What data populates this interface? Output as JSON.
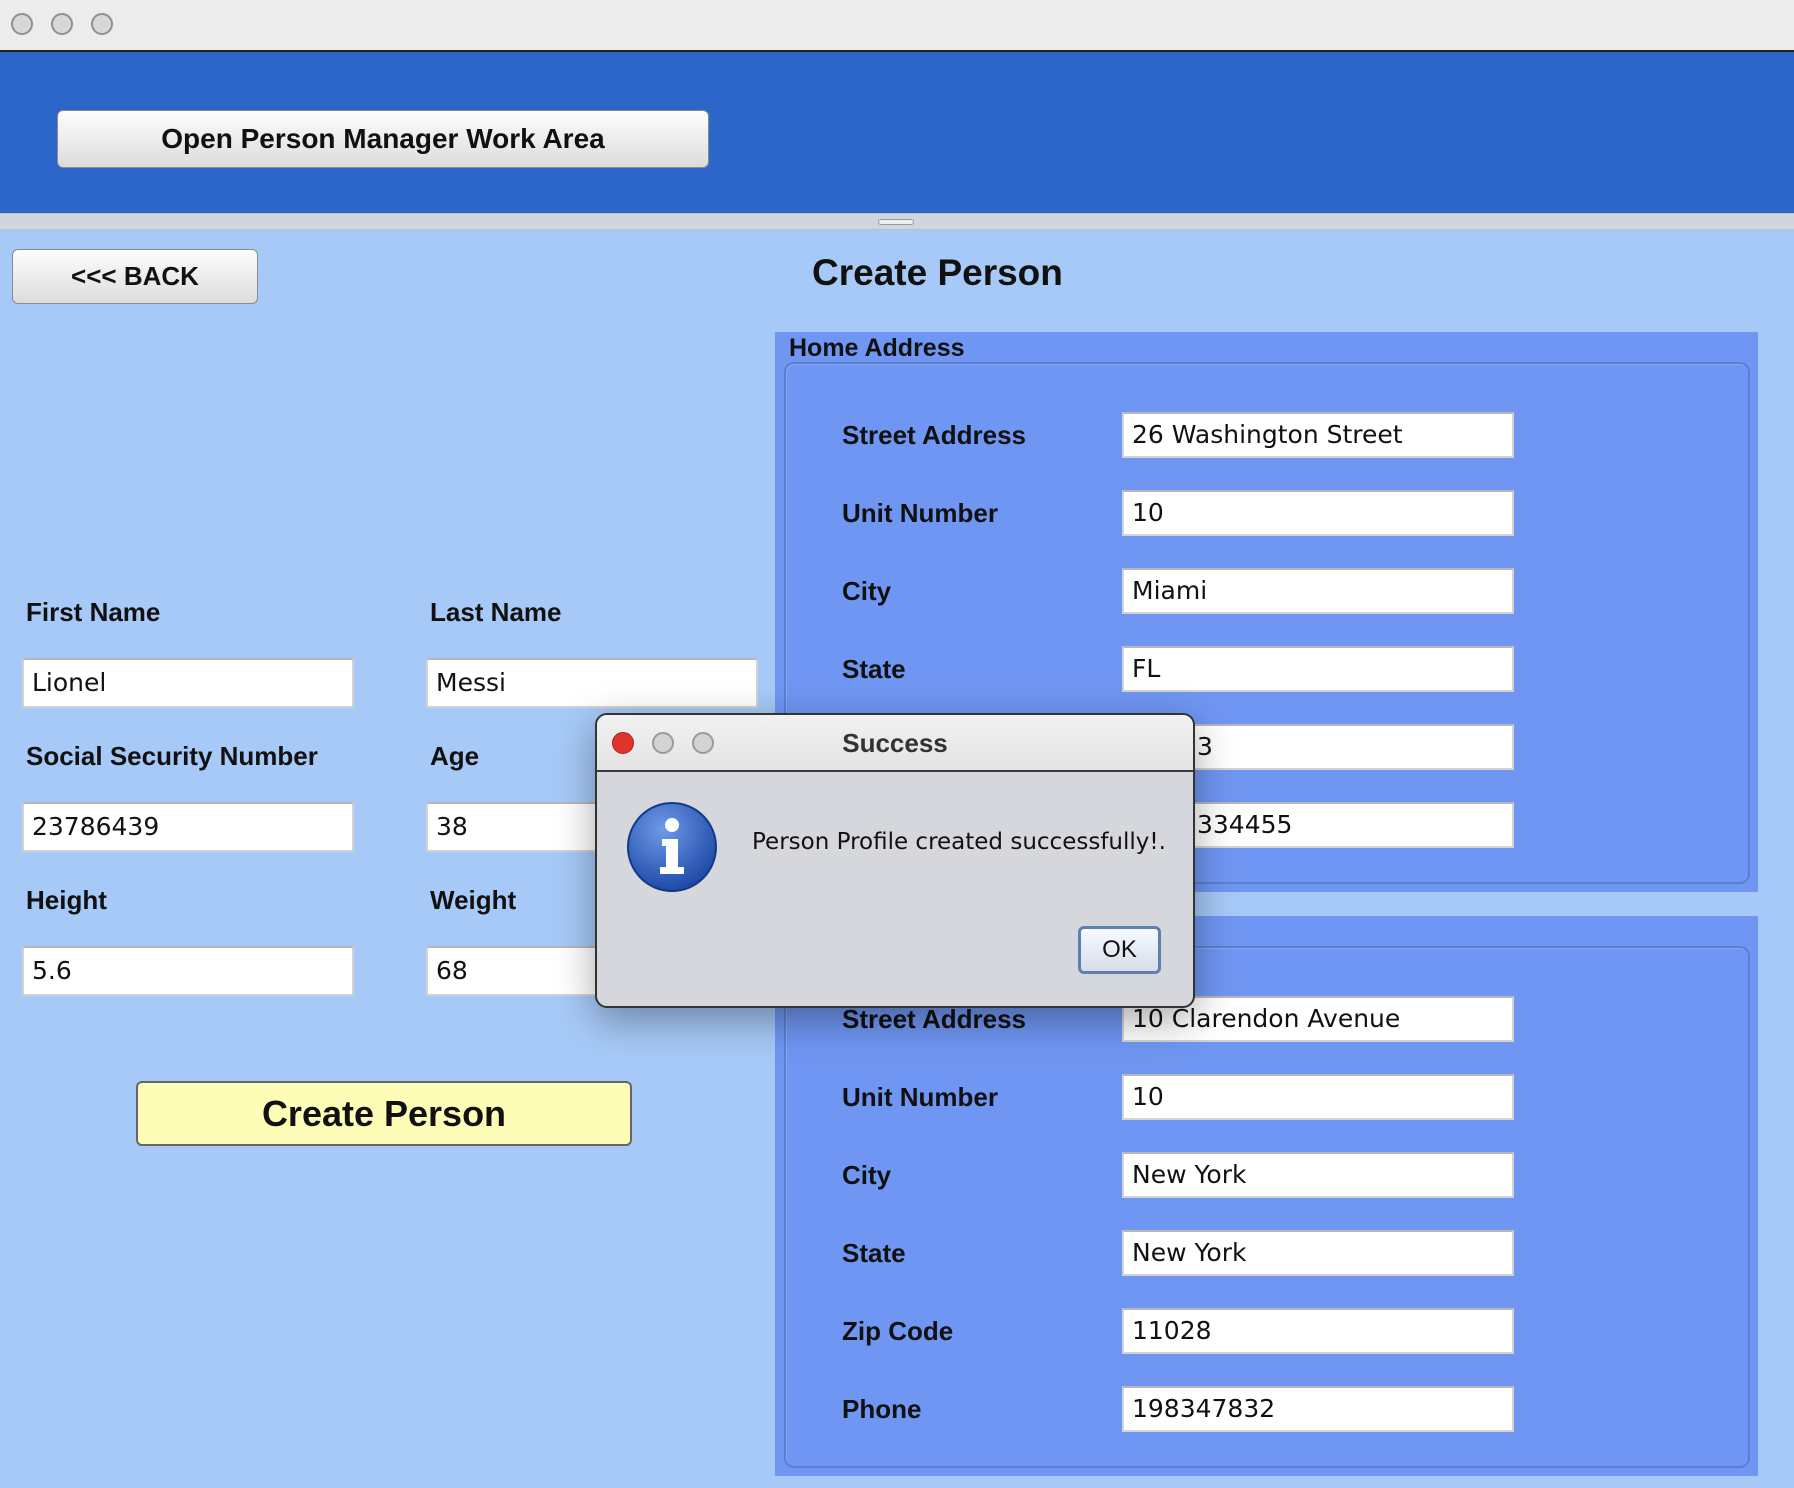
{
  "window": {
    "open_work_area_button": "Open Person Manager Work Area",
    "back_button": "<<< BACK",
    "page_title": "Create Person"
  },
  "person": {
    "first_name_label": "First Name",
    "first_name": "Lionel",
    "last_name_label": "Last Name",
    "last_name": "Messi",
    "ssn_label": "Social Security Number",
    "ssn": "23786439",
    "age_label": "Age",
    "age": "38",
    "height_label": "Height",
    "height": "5.6",
    "weight_label": "Weight",
    "weight": "68",
    "create_button": "Create Person"
  },
  "home_address": {
    "title": "Home Address",
    "street_label": "Street Address",
    "street": "26 Washington Street",
    "unit_label": "Unit Number",
    "unit": "10",
    "city_label": "City",
    "city": "Miami",
    "state_label": "State",
    "state": "FL",
    "zip_partial": "3",
    "phone_partial": "334455"
  },
  "work_address": {
    "street_label": "Street Address",
    "street": "10 Clarendon Avenue",
    "unit_label": "Unit Number",
    "unit": "10",
    "city_label": "City",
    "city": "New York",
    "state_label": "State",
    "state": "New York",
    "zip_label": "Zip Code",
    "zip": "11028",
    "phone_label": "Phone",
    "phone": "198347832"
  },
  "dialog": {
    "title": "Success",
    "message": "Person Profile created successfully!.",
    "ok_button": "OK",
    "icon": "info-icon"
  },
  "colors": {
    "top_bar": "#2c66c9",
    "background": "#a6c9f7",
    "address_panel": "#6f96f2",
    "create_button": "#fdfdb8",
    "close_red": "#e0332b"
  }
}
